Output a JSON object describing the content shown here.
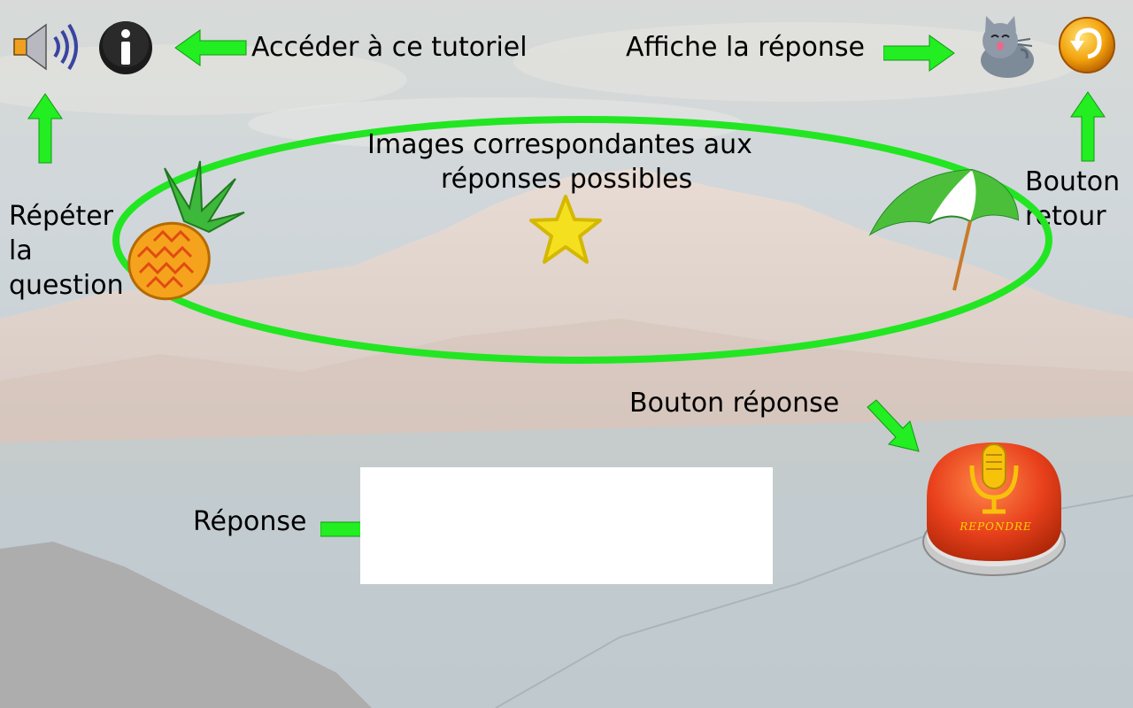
{
  "labels": {
    "tutorial": "Accéder à ce tutoriel",
    "show_answer": "Affiche la réponse",
    "images_line1": "Images correspondantes aux",
    "images_line2": "réponses possibles",
    "repeat_line1": "Répéter",
    "repeat_line2": "la",
    "repeat_line3": "question",
    "back_line1": "Bouton",
    "back_line2": "retour",
    "answer_button": "Bouton réponse",
    "answer": "Réponse"
  },
  "buttons": {
    "respond_text": "REPONDRE"
  },
  "answer_field": {
    "value": ""
  },
  "colors": {
    "arrow": "#22ee22",
    "ellipse": "#22e622",
    "respond_button": "#e8401c",
    "back_button": "#f2a20c"
  },
  "icons": [
    "speaker-icon",
    "info-icon",
    "cat-icon",
    "back-arrow-icon",
    "pineapple-icon",
    "star-icon",
    "beach-umbrella-icon",
    "microphone-icon"
  ]
}
